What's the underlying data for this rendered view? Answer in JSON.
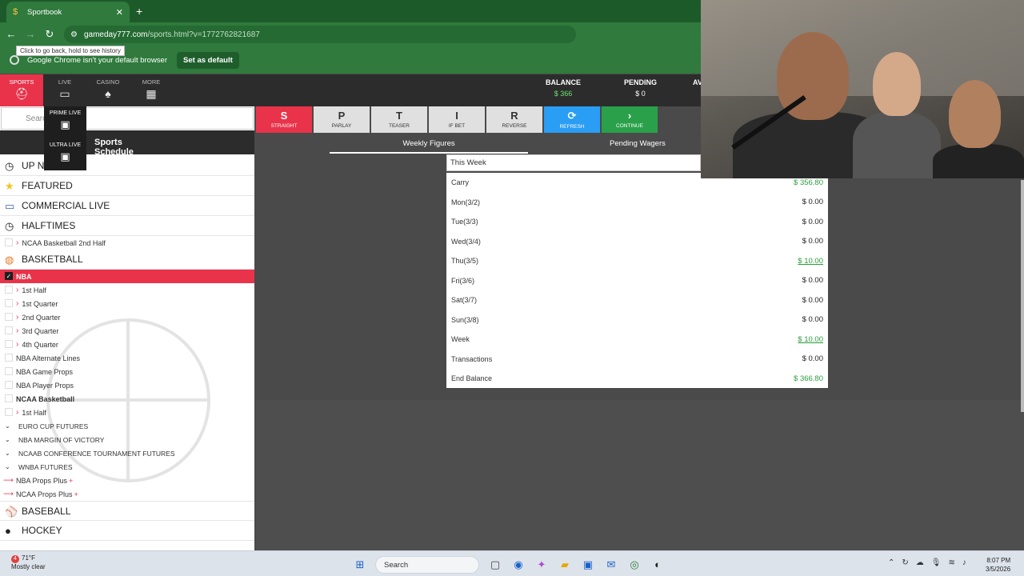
{
  "browser": {
    "tab_title": "Sportbook",
    "new_tab_glyph": "+",
    "url_host": "gameday777.com",
    "url_rest": "/sports.html?v=1772762821687",
    "tooltip": "Click to go back, hold to see history",
    "infobar_text": "Google Chrome isn't your default browser",
    "infobar_button": "Set as default"
  },
  "header": {
    "nav": [
      {
        "label": "SPORTS",
        "icon": "football-helmet-icon"
      },
      {
        "label": "LIVE",
        "icon": "monitor-icon"
      },
      {
        "label": "CASINO",
        "icon": "cards-icon"
      },
      {
        "label": "MORE",
        "icon": "grid-icon"
      }
    ],
    "balance_label": "BALANCE",
    "balance_value": "$ 366",
    "pending_label": "PENDING",
    "pending_value": "$ 0",
    "avail_label": "AV"
  },
  "flyout": {
    "prime": "PRIME LIVE",
    "ultra": "ULTRA LIVE"
  },
  "sidebar": {
    "search_placeholder": "Searc",
    "schedule_title": "Sports Schedule",
    "up_next": "UP N",
    "featured": "FEATURED",
    "commercial_live": "COMMERCIAL LIVE",
    "halftimes": "HALFTIMES",
    "halftimes_sub": "NCAA Basketball 2nd Half",
    "basketball": "BASKETBALL",
    "nba": "NBA",
    "nba_sub": [
      "1st Half",
      "1st Quarter",
      "2nd Quarter",
      "3rd Quarter",
      "4th Quarter"
    ],
    "nba_alt": "NBA Alternate Lines",
    "nba_game_props": "NBA Game Props",
    "nba_player_props": "NBA Player Props",
    "ncaa_basketball": "NCAA Basketball",
    "ncaa_first_half": "1st Half",
    "groups": [
      "EURO CUP FUTURES",
      "NBA MARGIN OF VICTORY",
      "NCAAB CONFERENCE TOURNAMENT FUTURES",
      "WNBA FUTURES"
    ],
    "plus_items": [
      "NBA Props Plus",
      "NCAA Props Plus"
    ],
    "plus_mark": "+",
    "baseball": "BASEBALL",
    "hockey": "HOCKEY"
  },
  "betbar": [
    {
      "key": "S",
      "label": "STRAIGHT"
    },
    {
      "key": "P",
      "label": "PARLAY"
    },
    {
      "key": "T",
      "label": "TEASER"
    },
    {
      "key": "I",
      "label": "IF BET"
    },
    {
      "key": "R",
      "label": "REVERSE"
    },
    {
      "key": "⟳",
      "label": "REFRESH"
    },
    {
      "key": "›",
      "label": "CONTINUE"
    }
  ],
  "tabs": {
    "weekly": "Weekly Figures",
    "pending": "Pending Wagers"
  },
  "week_select": "This Week",
  "figures": [
    {
      "label": "Carry",
      "amount": "$ 356.80",
      "style": "green"
    },
    {
      "label": "Mon(3/2)",
      "amount": "$ 0.00",
      "style": ""
    },
    {
      "label": "Tue(3/3)",
      "amount": "$ 0.00",
      "style": ""
    },
    {
      "label": "Wed(3/4)",
      "amount": "$ 0.00",
      "style": ""
    },
    {
      "label": "Thu(3/5)",
      "amount": "$ 10.00",
      "style": "link"
    },
    {
      "label": "Fri(3/6)",
      "amount": "$ 0.00",
      "style": ""
    },
    {
      "label": "Sat(3/7)",
      "amount": "$ 0.00",
      "style": ""
    },
    {
      "label": "Sun(3/8)",
      "amount": "$ 0.00",
      "style": ""
    },
    {
      "label": "Week",
      "amount": "$ 10.00",
      "style": "link"
    },
    {
      "label": "Transactions",
      "amount": "$ 0.00",
      "style": ""
    },
    {
      "label": "End Balance",
      "amount": "$ 366.80",
      "style": "green"
    }
  ],
  "taskbar": {
    "weather_badge": "4",
    "temp": "71°F",
    "condition": "Mostly clear",
    "search": "Search",
    "time": "8:07 PM",
    "date": "3/5/2026"
  },
  "colors": {
    "accent_red": "#e8334a",
    "refresh_blue": "#2a9df4",
    "continue_green": "#2aa04a",
    "chrome_green": "#2f7a3c"
  }
}
